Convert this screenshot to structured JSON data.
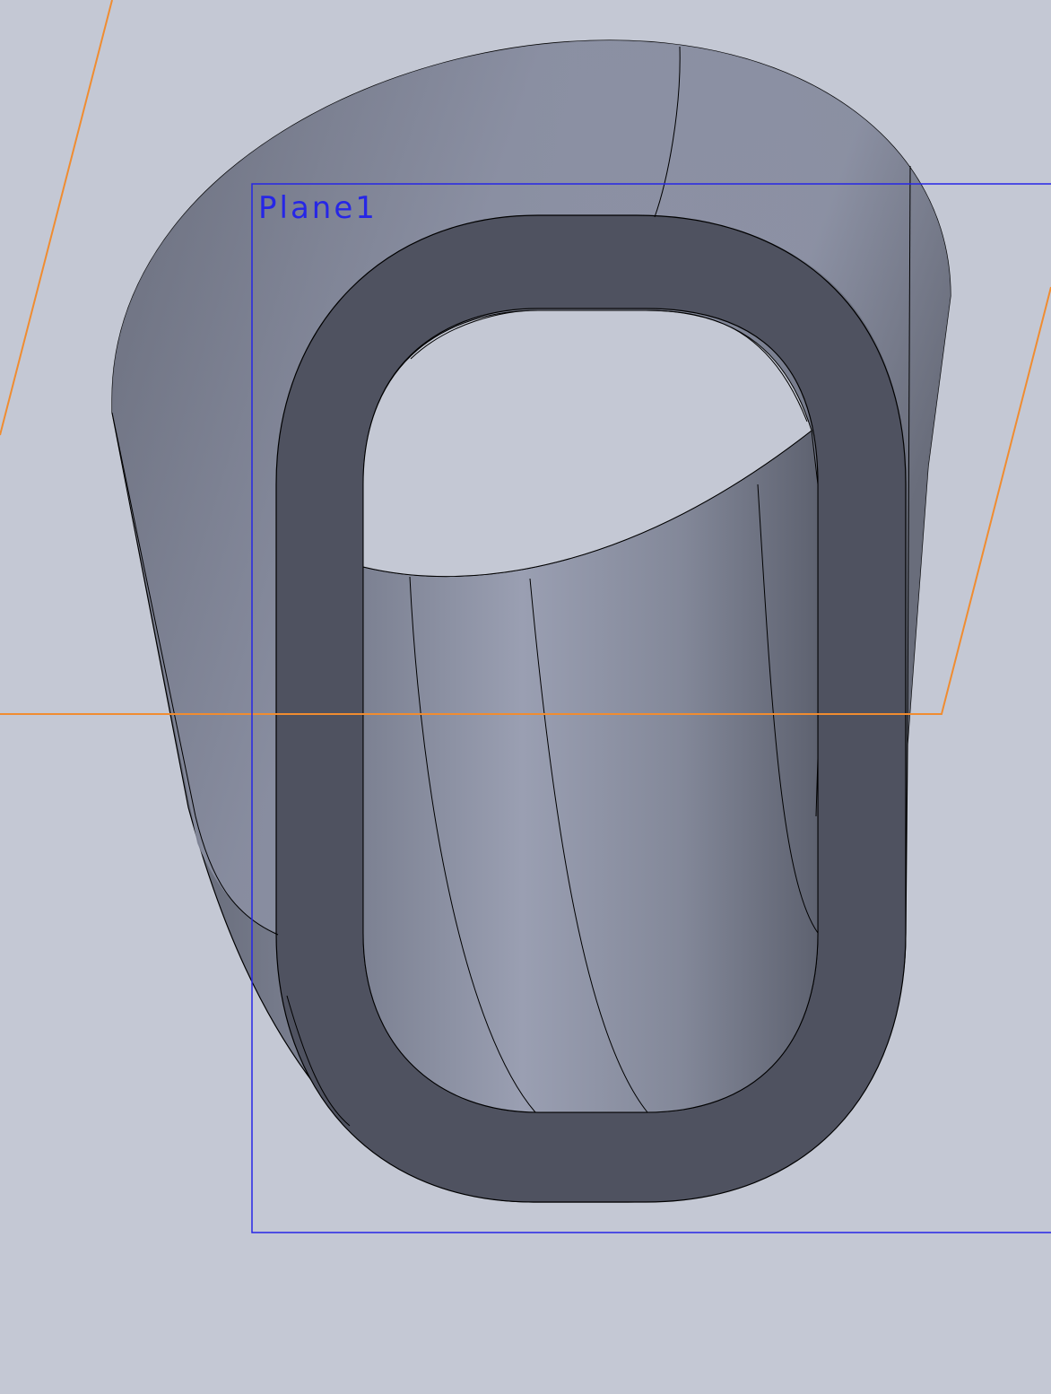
{
  "viewport": {
    "background": "#c4c8d4"
  },
  "planes": [
    {
      "name": "Plane1",
      "color": "#2626e6"
    }
  ],
  "reference_plane": {
    "color": "#f08c30"
  },
  "model": {
    "outer_surface_color": "#7f8493",
    "rim_face_color": "#4f5260",
    "edge_color": "#000000"
  }
}
